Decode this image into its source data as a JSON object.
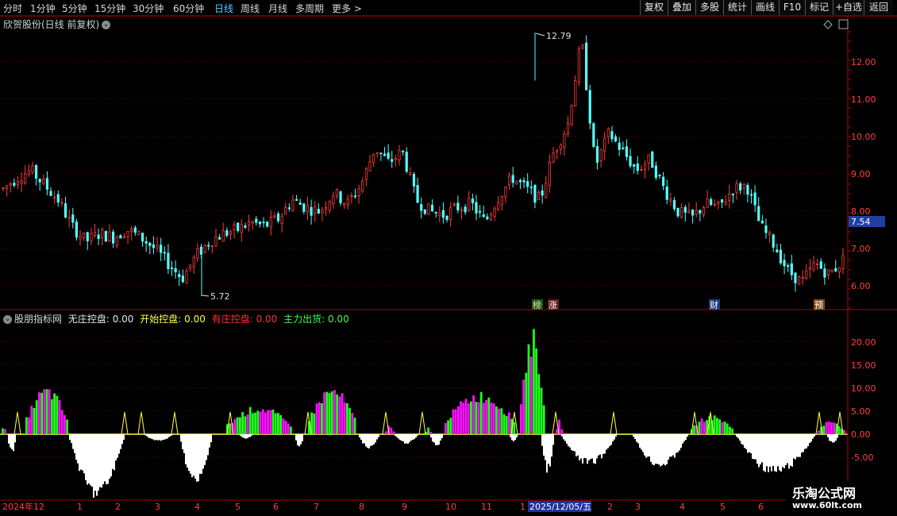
{
  "toolbar": {
    "periods": [
      "分时",
      "1分钟",
      "5分钟",
      "15分钟",
      "30分钟",
      "60分钟",
      "日线",
      "周线",
      "月线",
      "多周期",
      "更多 >"
    ],
    "active_period": "日线",
    "buttons": [
      "复权",
      "叠加",
      "多股",
      "统计",
      "画线",
      "F10",
      "标记",
      "+自选",
      "返回"
    ]
  },
  "price_panel": {
    "title": "欣贺股份(日线 前复权)",
    "high_label": "12.79",
    "low_label": "5.72",
    "current_price": "7.54",
    "y_ticks": [
      "12.00",
      "11.00",
      "10.00",
      "9.00",
      "8.00",
      "7.00",
      "6.00"
    ],
    "event_markers": [
      {
        "text": "榜",
        "color": "#3da33d"
      },
      {
        "text": "涨",
        "color": "#c03030"
      },
      {
        "text": "财",
        "color": "#2e6fd0"
      },
      {
        "text": "预",
        "color": "#d07020"
      }
    ]
  },
  "indicator_panel": {
    "name": "股朋指标网",
    "items": [
      {
        "label": "无庄控盘:",
        "value": "0.00",
        "color": "#e8e8e8"
      },
      {
        "label": "开始控盘:",
        "value": "0.00",
        "color": "#ffff40"
      },
      {
        "label": "有庄控盘:",
        "value": "0.00",
        "color": "#ff3030"
      },
      {
        "label": "主力出货:",
        "value": "0.00",
        "color": "#40ff40"
      }
    ],
    "y_ticks": [
      "20.00",
      "15.00",
      "10.00",
      "5.00",
      "0.00",
      "-5.00"
    ]
  },
  "time_axis": {
    "labels": [
      "2024年12",
      "1",
      "2",
      "3",
      "4",
      "5",
      "6",
      "7",
      "8",
      "9",
      "10",
      "11",
      "1",
      "2",
      "3",
      "4",
      "5",
      "6"
    ],
    "highlight": "2025/12/05/五"
  },
  "watermark": {
    "title": "乐淘公式网",
    "url": "www.60lt.com"
  },
  "colors": {
    "up": "#ff3c3c",
    "down": "#54ffff",
    "grid": "#6a0000",
    "axis": "#b00000",
    "magenta": "#ff10ff",
    "green": "#20ff20",
    "yellow": "#ffff40",
    "white": "#ffffff"
  },
  "chart_data": {
    "type": "candlestick-with-indicator",
    "price_range": [
      5.72,
      12.79
    ],
    "y_ticks": [
      6,
      7,
      8,
      9,
      10,
      11,
      12
    ],
    "current_price": 7.54,
    "close_path": [
      8.6,
      8.9,
      9.1,
      8.7,
      8.3,
      7.6,
      7.2,
      7.4,
      7.3,
      7.5,
      7.3,
      7.0,
      6.6,
      6.2,
      6.8,
      7.2,
      7.4,
      7.5,
      7.7,
      7.6,
      7.8,
      8.3,
      8.1,
      8.0,
      8.5,
      8.2,
      8.7,
      9.7,
      9.3,
      9.6,
      8.3,
      8.0,
      7.9,
      8.1,
      8.2,
      7.7,
      8.4,
      8.9,
      8.6,
      8.3,
      9.6,
      10.3,
      12.6,
      9.2,
      10.1,
      9.6,
      9.1,
      9.4,
      8.6,
      8.0,
      7.8,
      8.2,
      8.1,
      8.6,
      8.7,
      7.6,
      7.1,
      6.4,
      6.1,
      6.6,
      6.3,
      6.7
    ],
    "indicator_range": [
      -8,
      25
    ],
    "indicator_ticks": [
      20,
      15,
      10,
      5,
      0,
      -5
    ],
    "indicator_series": [
      "无庄控盘",
      "开始控盘",
      "有庄控盘",
      "主力出货"
    ]
  }
}
